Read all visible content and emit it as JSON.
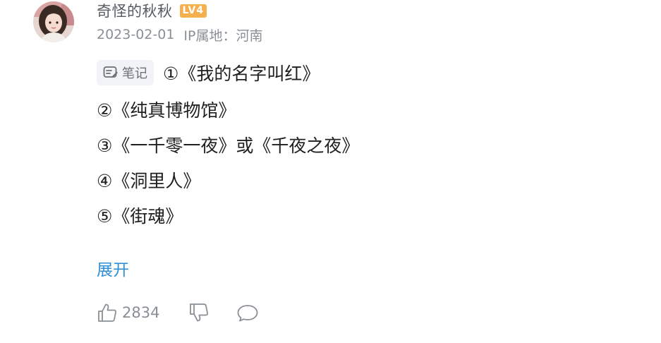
{
  "comment": {
    "user": {
      "name": "奇怪的秋秋",
      "level": "LV4"
    },
    "date": "2023-02-01",
    "location": "IP属地：河南",
    "tag": {
      "label": "笔记",
      "icon": "note-icon"
    },
    "lines": [
      "①《我的名字叫红》",
      "②《纯真博物馆》",
      "③《一千零一夜》或《千夜之夜》",
      "④《洞里人》",
      "⑤《街魂》"
    ],
    "expand_label": "展开",
    "actions": {
      "like_icon": "thumbs-up-icon",
      "like_count": "2834",
      "dislike_icon": "thumbs-down-icon",
      "reply_icon": "comment-bubble-icon"
    }
  },
  "colors": {
    "username": "#555a62",
    "meta": "#8a8f96",
    "body_text": "#1f1f1f",
    "link": "#2f8fd6",
    "level_badge": "#f5b04e",
    "tag_bg": "#f1f3f6"
  }
}
